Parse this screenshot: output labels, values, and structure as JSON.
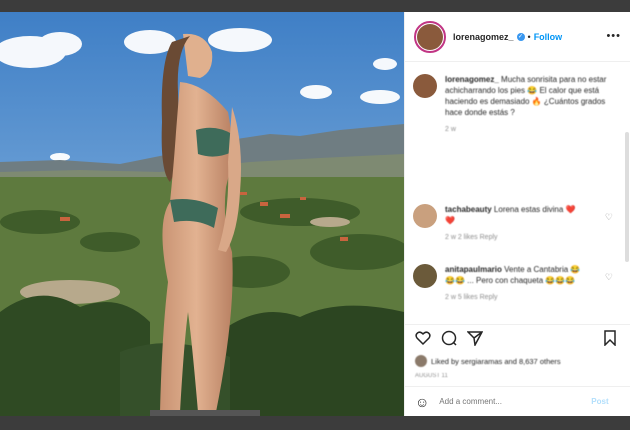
{
  "header": {
    "username": "lorenagomez_",
    "verified_icon": "verified-badge-icon",
    "separator": "•",
    "follow_label": "Follow",
    "more_label": "•••"
  },
  "comments": [
    {
      "username": "lorenagomez_",
      "text": "Mucha sonrisita para no estar achicharrando los pies 😂 El calor que está haciendo es demasiado 🔥 ¿Cuántos grados hace donde estás ?",
      "meta": "2 w",
      "avatar_color": "#8a5a3c"
    },
    {
      "username": "tachabeauty",
      "text": "Lorena estas divina ❤️❤️",
      "meta": "2 w   2 likes   Reply",
      "avatar_color": "#c9a07e"
    },
    {
      "username": "anitapaulmario",
      "text": "Vente a Cantabria 😂😂😂 ... Pero con chaqueta 😂😂😂",
      "meta": "2 w   5 likes   Reply",
      "avatar_color": "#6b5a3a"
    }
  ],
  "actions": {
    "like_icon": "heart-icon",
    "comment_icon": "comment-icon",
    "share_icon": "share-icon",
    "save_icon": "bookmark-icon"
  },
  "likes_text": "Liked by sergiaramas and 8,637 others",
  "date_text": "AUGUST 11",
  "add_comment": {
    "placeholder": "Add a comment...",
    "post_label": "Post",
    "emoji_icon": "smile-icon"
  },
  "colors": {
    "accent": "#0095f6",
    "ring": "#c13584",
    "sky": "#4a86c9"
  }
}
